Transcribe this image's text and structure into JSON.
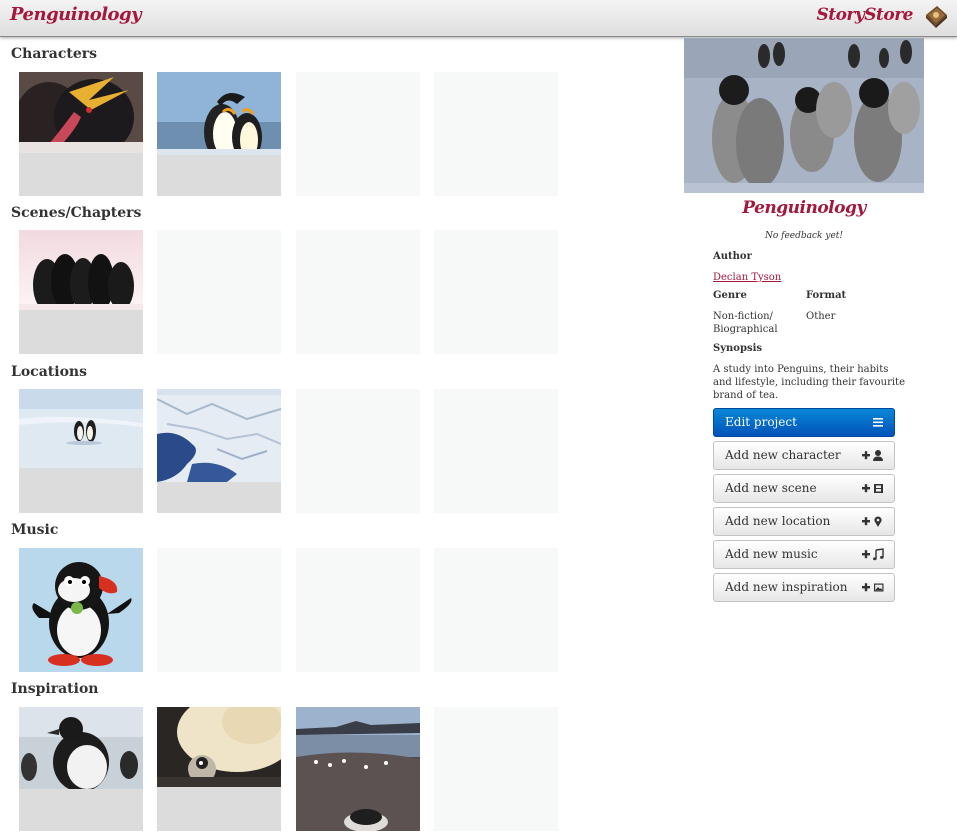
{
  "topbar": {
    "brand": "Penguinology",
    "store": "StoryStore"
  },
  "sections": {
    "characters": "Characters",
    "scenes": "Scenes/Chapters",
    "locations": "Locations",
    "music": "Music",
    "inspiration": "Inspiration"
  },
  "project": {
    "title": "Penguinology",
    "feedback": "No feedback yet!",
    "author_label": "Author",
    "author": "Declan Tyson",
    "genre_label": "Genre",
    "genre_line1": "Non-fiction/",
    "genre_line2": "Biographical",
    "format_label": "Format",
    "format": "Other",
    "synopsis_label": "Synopsis",
    "synopsis_line1": "A study into Penguins, their habits",
    "synopsis_line2": "and lifestyle, including their favourite",
    "synopsis_line3": "brand of tea."
  },
  "actions": {
    "edit": "Edit project",
    "character": "Add new character",
    "scene": "Add new scene",
    "location": "Add new location",
    "music": "Add new music",
    "inspiration": "Add new inspiration"
  },
  "icons": {
    "book": "book-icon",
    "menu": "menu-icon",
    "user": "user-icon",
    "film": "film-icon",
    "pin": "map-pin-icon",
    "note": "music-note-icon",
    "picture": "picture-icon"
  },
  "colors": {
    "brand": "#a4183c",
    "primary_button": "#0a6fd0",
    "tile_empty": "#f7f8f8",
    "tile_filled": "#dcdcdc"
  }
}
